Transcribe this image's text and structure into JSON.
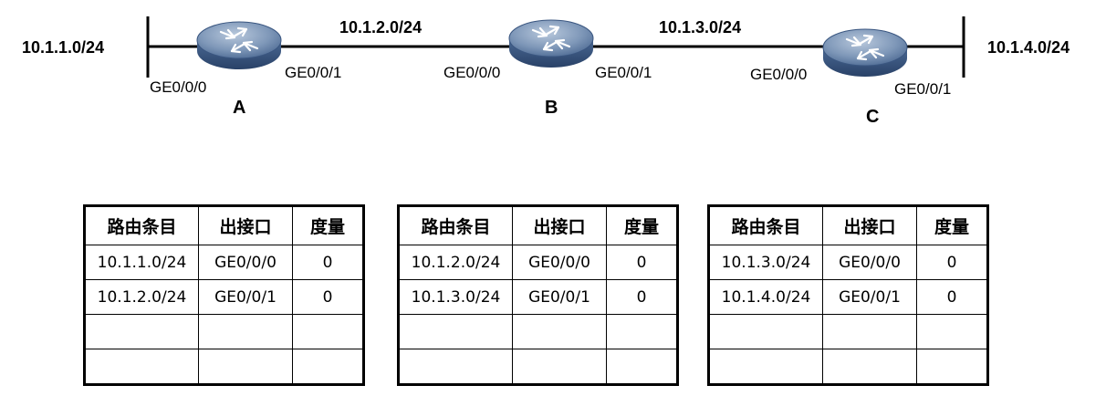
{
  "networks": {
    "left": "10.1.1.0/24",
    "ab": "10.1.2.0/24",
    "bc": "10.1.3.0/24",
    "right": "10.1.4.0/24"
  },
  "routers": [
    {
      "name": "A",
      "left_port": "GE0/0/0",
      "right_port": "GE0/0/1"
    },
    {
      "name": "B",
      "left_port": "GE0/0/0",
      "right_port": "GE0/0/1"
    },
    {
      "name": "C",
      "left_port": "GE0/0/0",
      "right_port": "GE0/0/1"
    }
  ],
  "table_headers": [
    "路由条目",
    "出接口",
    "度量"
  ],
  "tables": [
    {
      "rows": [
        [
          "10.1.1.0/24",
          "GE0/0/0",
          "0"
        ],
        [
          "10.1.2.0/24",
          "GE0/0/1",
          "0"
        ],
        [
          "",
          "",
          ""
        ],
        [
          "",
          "",
          ""
        ]
      ]
    },
    {
      "rows": [
        [
          "10.1.2.0/24",
          "GE0/0/0",
          "0"
        ],
        [
          "10.1.3.0/24",
          "GE0/0/1",
          "0"
        ],
        [
          "",
          "",
          ""
        ],
        [
          "",
          "",
          ""
        ]
      ]
    },
    {
      "rows": [
        [
          "10.1.3.0/24",
          "GE0/0/0",
          "0"
        ],
        [
          "10.1.4.0/24",
          "GE0/0/1",
          "0"
        ],
        [
          "",
          "",
          ""
        ],
        [
          "",
          "",
          ""
        ]
      ]
    }
  ],
  "colors": {
    "router_top": "#8ea6c4",
    "router_side": "#3c5a86",
    "line": "#000000"
  }
}
